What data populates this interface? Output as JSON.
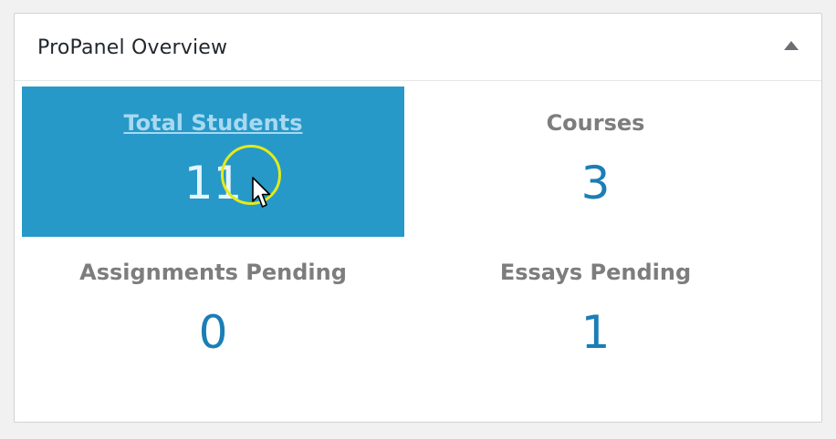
{
  "panel": {
    "title": "ProPanel Overview",
    "toggle_icon": "triangle-up-icon"
  },
  "stats": [
    {
      "label": "Total Students",
      "value": "11",
      "active": true
    },
    {
      "label": "Courses",
      "value": "3",
      "active": false
    },
    {
      "label": "Assignments Pending",
      "value": "0",
      "active": false
    },
    {
      "label": "Essays Pending",
      "value": "1",
      "active": false
    }
  ],
  "colors": {
    "active_tile_bg": "#2699c8",
    "value_blue": "#1b7eb5",
    "label_gray": "#7d7d7d",
    "highlight_ring": "#e4ea1a"
  },
  "overlay": {
    "cursor_icon": "mouse-pointer-icon",
    "highlight_icon": "click-highlight-ring"
  }
}
